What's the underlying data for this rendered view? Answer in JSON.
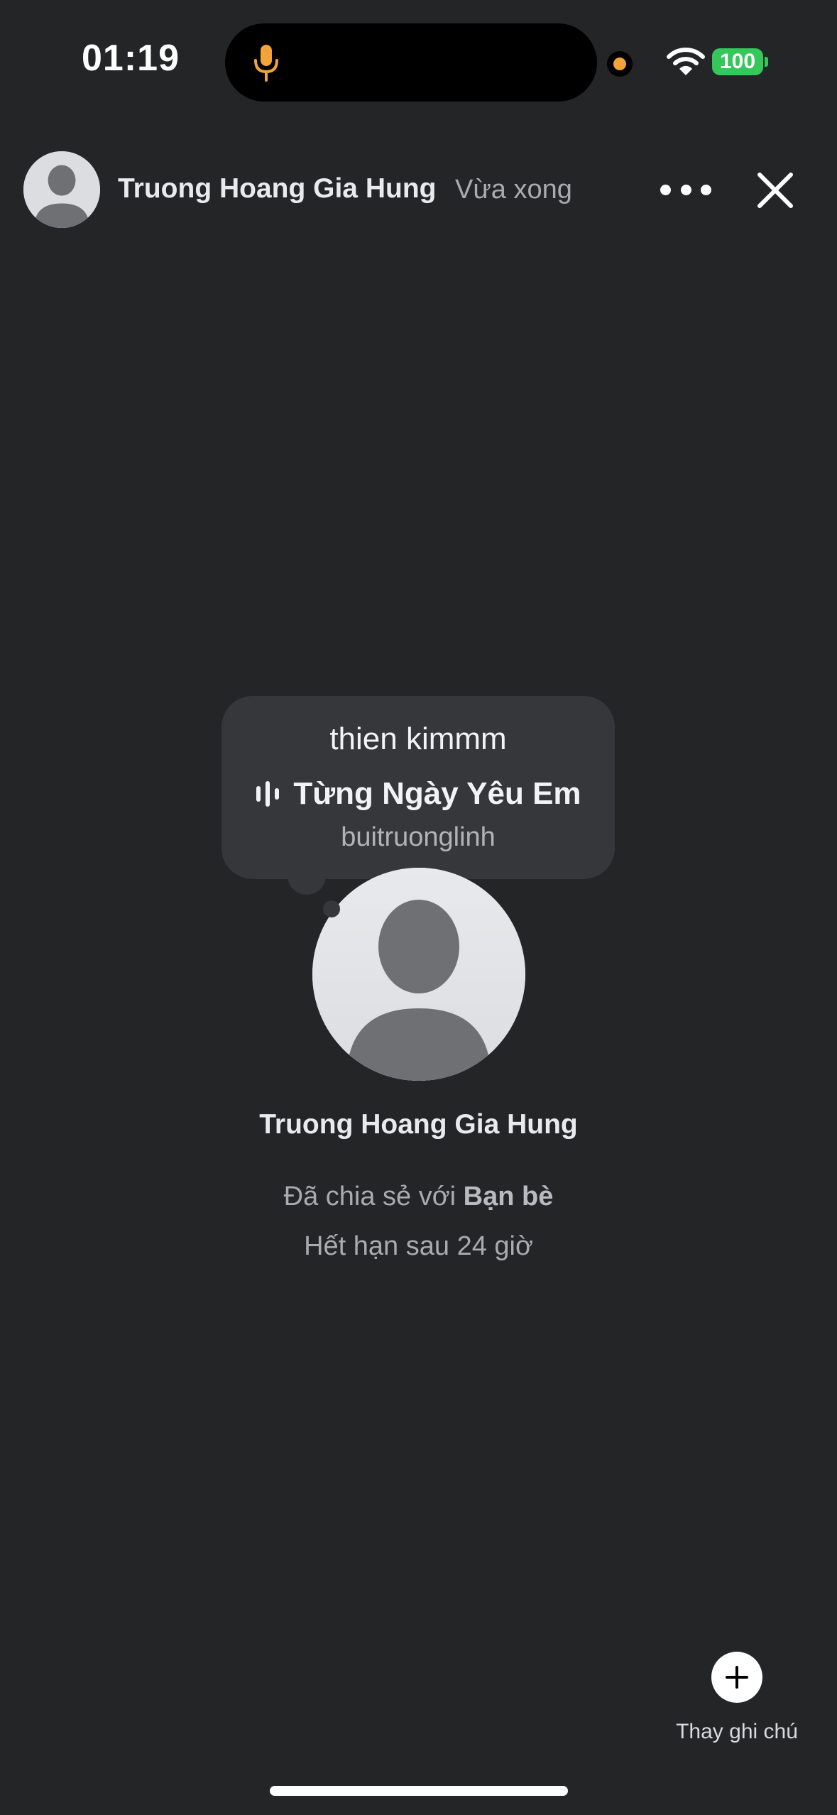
{
  "status_bar": {
    "time": "01:19",
    "battery": "100",
    "mic_icon": "microphone-icon",
    "wifi_icon": "wifi-icon"
  },
  "header": {
    "avatar_icon": "user-silhouette-icon",
    "name": "Truong Hoang Gia Hung",
    "time": "Vừa xong",
    "more_icon": "ellipsis-icon",
    "close_icon": "close-icon"
  },
  "note": {
    "text": "thien kimmm",
    "song_icon": "audio-wave-icon",
    "song_title": "Từng Ngày Yêu Em",
    "song_artist": "buitruonglinh"
  },
  "profile": {
    "avatar_icon": "user-silhouette-icon",
    "name": "Truong Hoang Gia Hung",
    "shared_prefix": "Đã chia sẻ với",
    "shared_audience": "Bạn bè",
    "expiry": "Hết hạn sau 24 giờ"
  },
  "actions": {
    "change_note_icon": "plus-icon",
    "change_note_label": "Thay ghi chú"
  },
  "colors": {
    "background": "#242526",
    "bubble": "#36373a",
    "battery": "#34c759",
    "mic": "#f2a33a"
  }
}
